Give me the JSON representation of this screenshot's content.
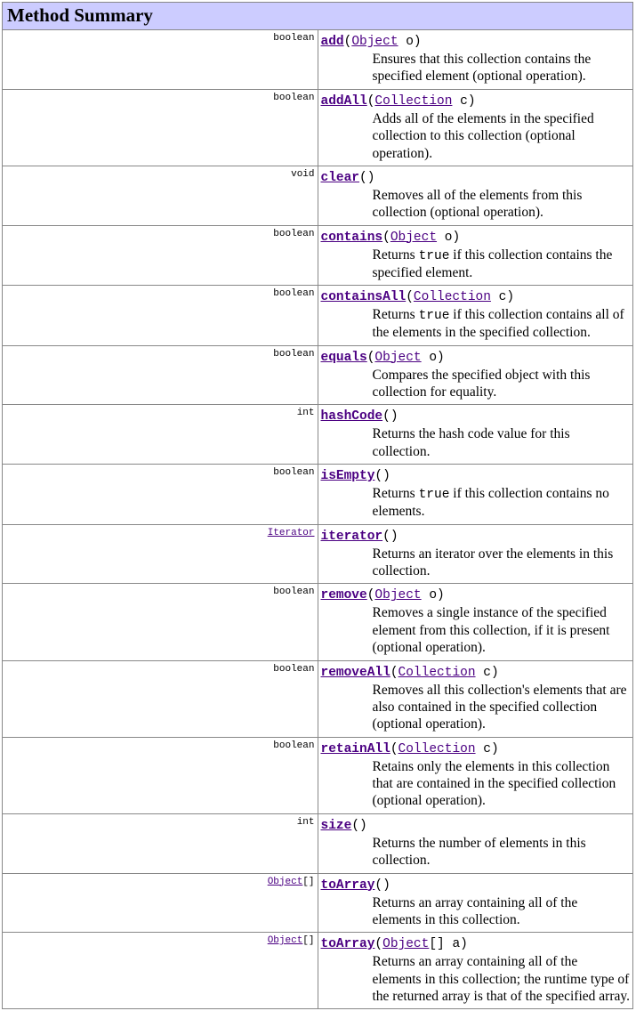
{
  "title": "Method Summary",
  "types": {
    "Object": "Object",
    "Collection": "Collection",
    "Iterator": "Iterator",
    "ObjectArr": "Object"
  },
  "methods": [
    {
      "ret_plain": "boolean",
      "name": "add",
      "open": "(",
      "ptype": "Object",
      "pvar": " o)",
      "desc_pre": "Ensures that this collection contains the specified element (optional operation).",
      "desc_true": "",
      "desc_post": ""
    },
    {
      "ret_plain": "boolean",
      "name": "addAll",
      "open": "(",
      "ptype": "Collection",
      "pvar": " c)",
      "desc_pre": "Adds all of the elements in the specified collection to this collection (optional operation).",
      "desc_true": "",
      "desc_post": ""
    },
    {
      "ret_plain": "void",
      "name": "clear",
      "open": "()",
      "ptype": "",
      "pvar": "",
      "desc_pre": "Removes all of the elements from this collection (optional operation).",
      "desc_true": "",
      "desc_post": ""
    },
    {
      "ret_plain": "boolean",
      "name": "contains",
      "open": "(",
      "ptype": "Object",
      "pvar": " o)",
      "desc_pre": "Returns ",
      "desc_true": "true",
      "desc_post": " if this collection contains the specified element."
    },
    {
      "ret_plain": "boolean",
      "name": "containsAll",
      "open": "(",
      "ptype": "Collection",
      "pvar": " c)",
      "desc_pre": "Returns ",
      "desc_true": "true",
      "desc_post": " if this collection contains all of the elements in the specified collection."
    },
    {
      "ret_plain": "boolean",
      "name": "equals",
      "open": "(",
      "ptype": "Object",
      "pvar": " o)",
      "desc_pre": "Compares the specified object with this collection for equality.",
      "desc_true": "",
      "desc_post": ""
    },
    {
      "ret_plain": "int",
      "name": "hashCode",
      "open": "()",
      "ptype": "",
      "pvar": "",
      "desc_pre": "Returns the hash code value for this collection.",
      "desc_true": "",
      "desc_post": ""
    },
    {
      "ret_plain": "boolean",
      "name": "isEmpty",
      "open": "()",
      "ptype": "",
      "pvar": "",
      "desc_pre": "Returns ",
      "desc_true": "true",
      "desc_post": " if this collection contains no elements."
    },
    {
      "ret_link": "Iterator",
      "name": "iterator",
      "open": "()",
      "ptype": "",
      "pvar": "",
      "desc_pre": "Returns an iterator over the elements in this collection.",
      "desc_true": "",
      "desc_post": ""
    },
    {
      "ret_plain": "boolean",
      "name": "remove",
      "open": "(",
      "ptype": "Object",
      "pvar": " o)",
      "desc_pre": "Removes a single instance of the specified element from this collection, if it is present (optional operation).",
      "desc_true": "",
      "desc_post": ""
    },
    {
      "ret_plain": "boolean",
      "name": "removeAll",
      "open": "(",
      "ptype": "Collection",
      "pvar": " c)",
      "desc_pre": "Removes all this collection's elements that are also contained in the specified collection (optional operation).",
      "desc_true": "",
      "desc_post": ""
    },
    {
      "ret_plain": "boolean",
      "name": "retainAll",
      "open": "(",
      "ptype": "Collection",
      "pvar": " c)",
      "desc_pre": "Retains only the elements in this collection that are contained in the specified collection (optional operation).",
      "desc_true": "",
      "desc_post": ""
    },
    {
      "ret_plain": "int",
      "name": "size",
      "open": "()",
      "ptype": "",
      "pvar": "",
      "desc_pre": "Returns the number of elements in this collection.",
      "desc_true": "",
      "desc_post": ""
    },
    {
      "ret_link": "Object",
      "ret_suffix": "[]",
      "name": "toArray",
      "open": "()",
      "ptype": "",
      "pvar": "",
      "desc_pre": "Returns an array containing all of the elements in this collection.",
      "desc_true": "",
      "desc_post": ""
    },
    {
      "ret_link": "Object",
      "ret_suffix": "[]",
      "name": "toArray",
      "open": "(",
      "ptype": "Object",
      "pvar": "[] a)",
      "desc_pre": "Returns an array containing all of the elements in this collection; the runtime type of the returned array is that of the specified array.",
      "desc_true": "",
      "desc_post": ""
    }
  ]
}
